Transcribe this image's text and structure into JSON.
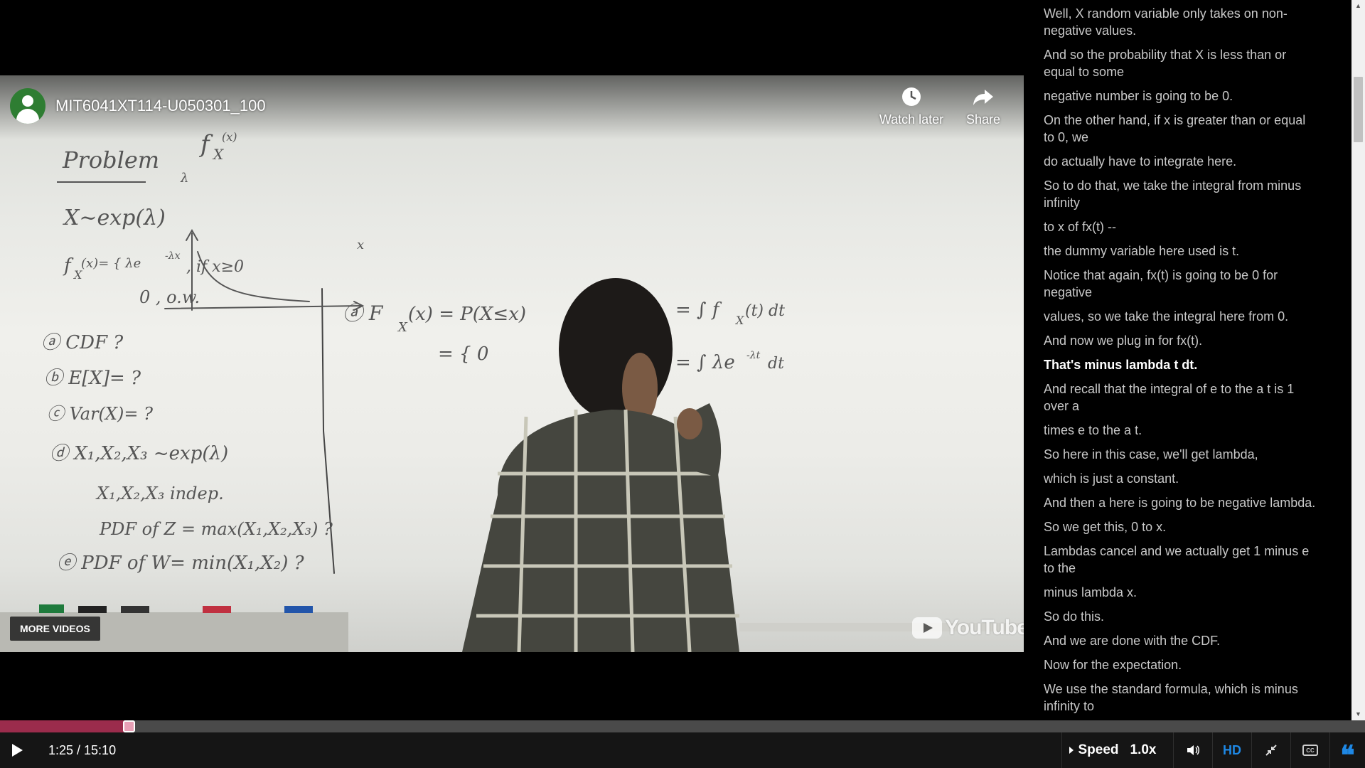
{
  "video": {
    "title": "MIT6041XT114-U050301_100",
    "watch_later_label": "Watch later",
    "share_label": "Share",
    "more_videos_label": "MORE VIDEOS",
    "logo_text": "YouTube"
  },
  "transcript": {
    "lines": [
      "Well, X random variable only takes on non-negative values.",
      "And so the probability that X is less than or equal to some",
      "negative number is going to be 0.",
      "On the other hand, if x is greater than or equal to 0, we",
      "do actually have to integrate here.",
      "So to do that, we take the integral from minus infinity",
      "to x of fx(t) --",
      "the dummy variable here used is t.",
      "Notice that again, fx(t) is going to be 0 for negative",
      "values, so we take the integral here from 0.",
      "And now we plug in for fx(t).",
      "That's minus lambda t dt.",
      "And recall that the integral of e to the a t is 1 over a",
      "times e to the a t.",
      "So here in this case, we'll get lambda,",
      "which is just a constant.",
      "And then a here is going to be negative lambda.",
      "So we get this, 0 to x.",
      "Lambdas cancel and we actually get 1 minus e to the",
      "minus lambda x.",
      "So do this.",
      "And we are done with the CDF.",
      "Now for the expectation.",
      "We use the standard formula, which is minus infinity to"
    ],
    "current_index": 11
  },
  "controls": {
    "time": "1:25 / 15:10",
    "progress_fraction": 0.0934,
    "speed_label": "Speed",
    "speed_value": "1.0x",
    "hd_label": "HD",
    "cc_label": "CC",
    "quote_label": "❝"
  },
  "colors": {
    "progress_fill": "#9b2c4c",
    "accent_blue": "#1e88e5",
    "avatar_green": "#2e7d32"
  }
}
